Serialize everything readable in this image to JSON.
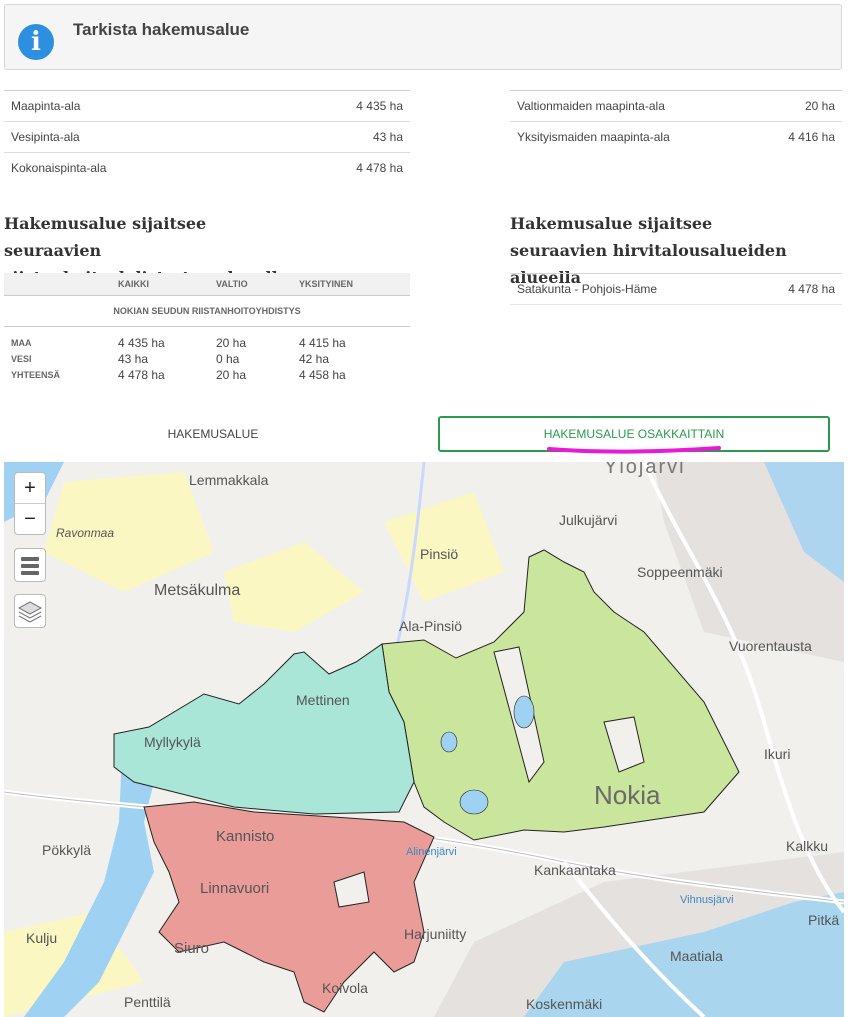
{
  "header": {
    "title": "Tarkista hakemusalue"
  },
  "areas_left": [
    {
      "label": "Maapinta-ala",
      "value": "4 435 ha"
    },
    {
      "label": "Vesipinta-ala",
      "value": "43 ha"
    },
    {
      "label": "Kokonaispinta-ala",
      "value": "4 478 ha"
    }
  ],
  "areas_right": [
    {
      "label": "Valtionmaiden maapinta-ala",
      "value": "20 ha"
    },
    {
      "label": "Yksityismaiden maapinta-ala",
      "value": "4 416 ha"
    }
  ],
  "rhy": {
    "heading": "Hakemusalue sijaitsee seuraavien riistanhoitoyhdistysten alueella",
    "columns": [
      "KAIKKI",
      "VALTIO",
      "YKSITYINEN"
    ],
    "name": "NOKIAN SEUDUN RIISTANHOITOYHDISTYS",
    "rows": [
      {
        "label": "MAA",
        "kaikki": "4 435 ha",
        "valtio": "20 ha",
        "yksityinen": "4 415 ha"
      },
      {
        "label": "VESI",
        "kaikki": "43 ha",
        "valtio": "0 ha",
        "yksityinen": "42 ha"
      },
      {
        "label": "YHTEENSÄ",
        "kaikki": "4 478 ha",
        "valtio": "20 ha",
        "yksityinen": "4 458 ha"
      }
    ]
  },
  "hirvi": {
    "heading": "Hakemusalue sijaitsee seuraavien hirvitalousalueiden alueella",
    "rows": [
      {
        "label": "Satakunta - Pohjois-Häme",
        "value": "4 478 ha"
      }
    ]
  },
  "tabs": {
    "area": "HAKEMUSALUE",
    "by_owner": "HAKEMUSALUE OSAKKAITTAIN"
  },
  "map": {
    "zoom_in": "+",
    "zoom_out": "−",
    "places": [
      "Ylöjärvi",
      "Lemmakkala",
      "Ravonmaa",
      "Julkujärvi",
      "Pinsiö",
      "Soppeenmäki",
      "Metsäkulma",
      "Ala-Pinsiö",
      "Vuorentausta",
      "Mettinen",
      "Myllykylä",
      "Ikuri",
      "Nokia",
      "Kannisto",
      "Pökkylä",
      "Kalkku",
      "Kankaantaka",
      "Linnavuori",
      "Kulju",
      "Siuro",
      "Harjuniitty",
      "Pitkä",
      "Maatiala",
      "Penttilä",
      "Koivola",
      "Koskenmäki",
      "Alinenjärvi",
      "Vihnusjärvi"
    ],
    "colors": {
      "osakas_1": "#c9e69c",
      "osakas_2": "#a9e6d8",
      "osakas_3": "#ea9c98",
      "water": "#9fd2f2",
      "annotation": "#e81ad6"
    }
  }
}
